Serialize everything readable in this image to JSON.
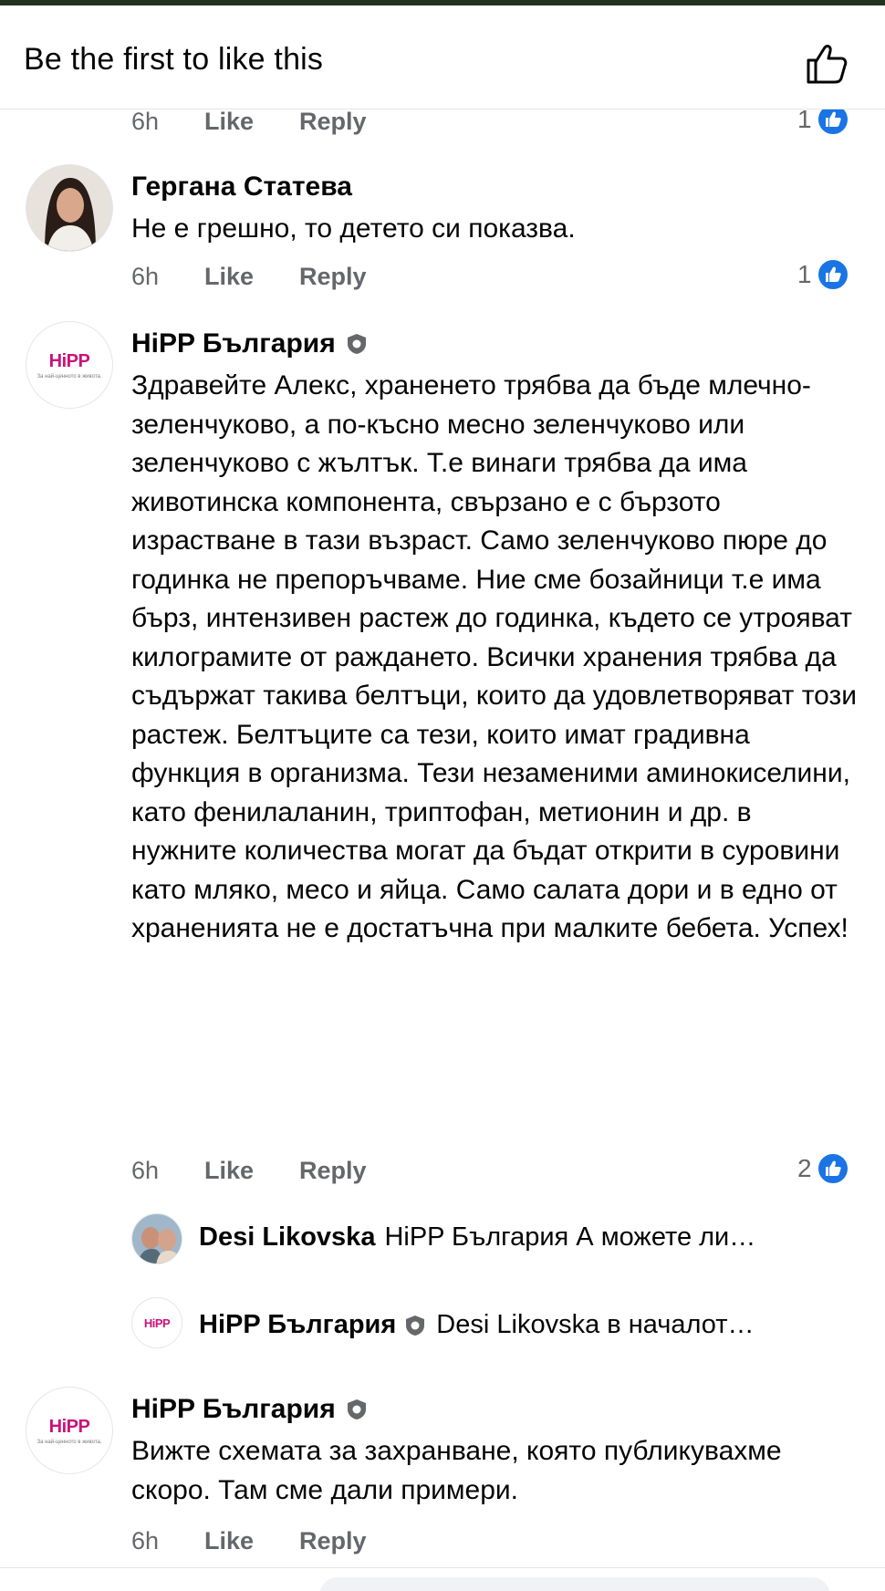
{
  "header": {
    "title": "Be the first to like this"
  },
  "prev_comment": {
    "time": "6h",
    "like": "Like",
    "reply": "Reply",
    "reactions": "1"
  },
  "comments": [
    {
      "author": "Гергана Статева",
      "text": "Не е грешно, то детето си показва.",
      "time": "6h",
      "like": "Like",
      "reply": "Reply",
      "reactions": "1"
    },
    {
      "author": "HiPP България",
      "text": "Здравейте Алекс, храненето трябва да бъде млечно-зеленчуково, а по-късно месно зеленчуково или зеленчуково с жълтък. Т.е винаги трябва да има животинска компонента, свързано е с бързото израстване в тази възраст. Само зеленчуково пюре до годинка не препоръчваме. Ние сме бозайници т.е има бърз, интензивен растеж до годинка, където се утрояват килограмите от раждането. Всички хранения трябва да съдържат такива белтъци, които да удовлетворяват този растеж. Белтъците са тези, които имат градивна функция в организма. Тези незаменими аминокиселини, като фенилаланин, триптофан, метионин и др. в нужните количества могат да бъдат открити в суровини като мляко, месо и яйца. Само салата дори и в едно от храненията не е достатъчна при малките бебета. Успех!",
      "time": "6h",
      "like": "Like",
      "reply": "Reply",
      "reactions": "2",
      "replies": [
        {
          "author": "Desi Likovska",
          "text": "HiPP България А можете ли…"
        },
        {
          "author": "HiPP България",
          "text": "Desi Likovska в началот…"
        }
      ]
    },
    {
      "author": "HiPP България",
      "text": "Вижте схемата за захранване, която публикувахме скоро. Там сме дали примери.",
      "time": "6h",
      "like": "Like",
      "reply": "Reply"
    }
  ],
  "brand": {
    "logo_text": "HiPP",
    "logo_tagline": "За най-ценното в живота."
  },
  "colors": {
    "accent": "#1b74e4",
    "secondary_text": "#65676b",
    "hipp_magenta": "#c8147a"
  }
}
